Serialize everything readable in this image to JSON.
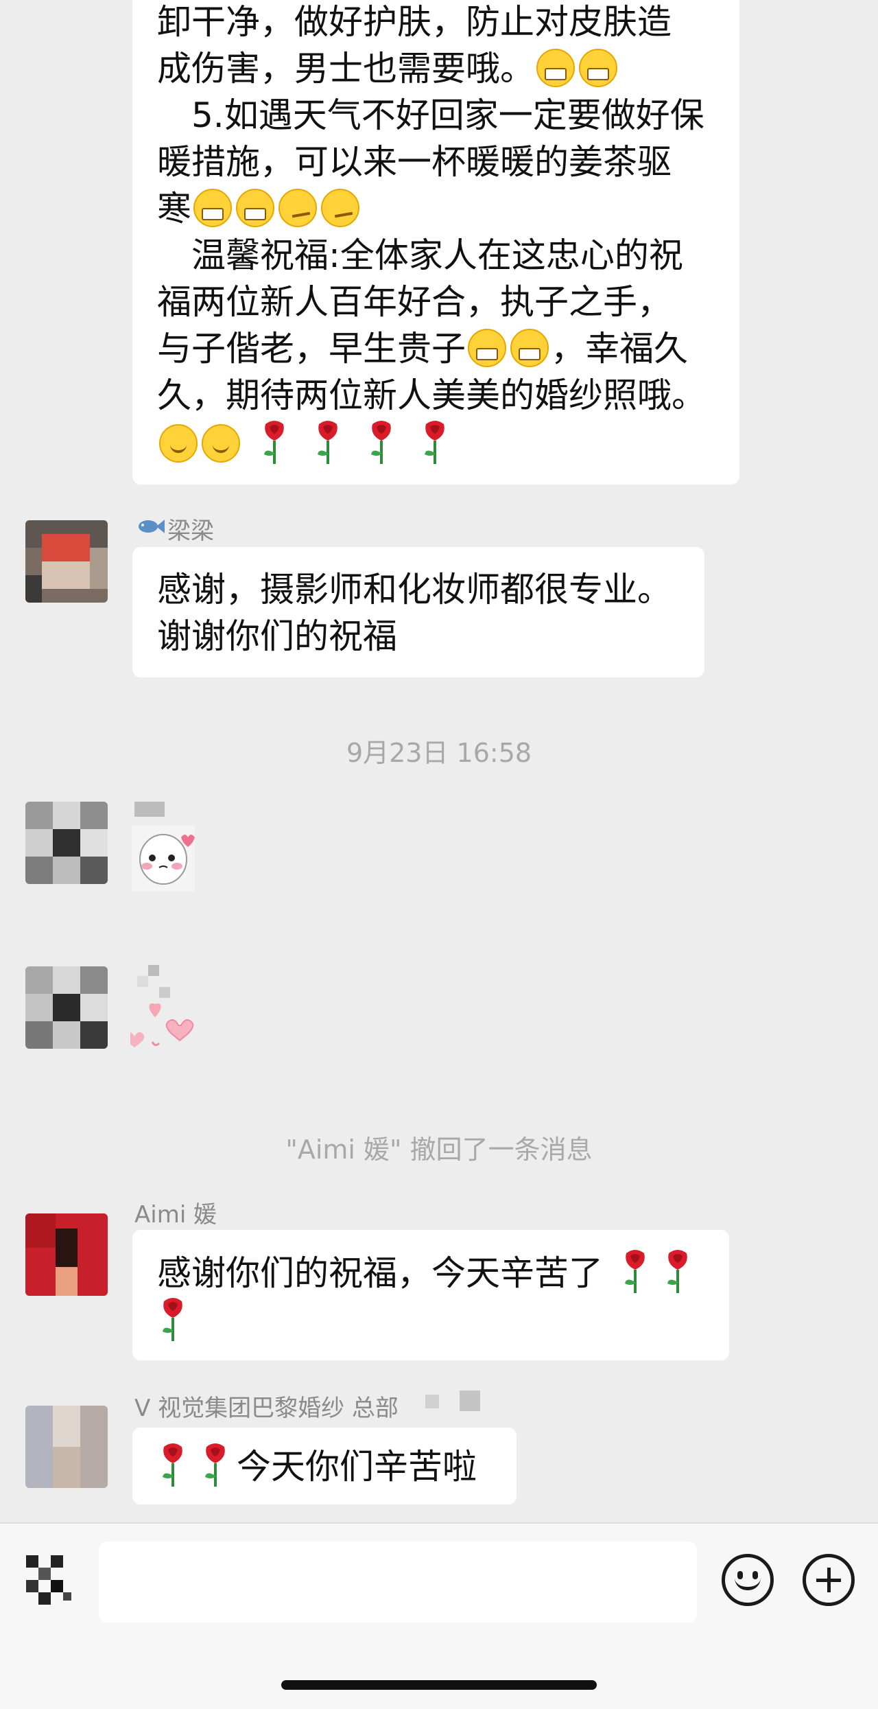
{
  "chat": {
    "messages": {
      "first": {
        "lines": [
          "卸干净，做好护肤，防止对皮肤造",
          "成伤害，男士也需要哦。",
          "　5.如遇天气不好回家一定要做好保",
          "暖措施，可以来一杯暖暖的姜茶驱",
          "寒",
          "　温馨祝福:全体家人在这忠心的祝",
          "福两位新人百年好合，执子之手，",
          "与子偕老，早生贵子",
          "，幸福久",
          "久，期待两位新人美美的婚纱照哦。"
        ]
      },
      "liangliang": {
        "sender": "梁梁",
        "lines": [
          "感谢，摄影师和化妆师都很专业。",
          "谢谢你们的祝福"
        ]
      },
      "aimi": {
        "sender": "Aimi 媛",
        "lines": [
          "感谢你们的祝福，今天辛苦了"
        ]
      },
      "vvision": {
        "sender": "V 视觉集团巴黎婚纱 总部",
        "text": "今天你们辛苦啦"
      }
    },
    "timestamp": "9月23日 16:58",
    "recall_notice": "\"Aimi 媛\" 撤回了一条消息"
  },
  "icons": {
    "grin": "grinning-face-emoji",
    "smile": "smiling-face-emoji",
    "smirk": "smirking-face-emoji",
    "rose": "rose-emoji",
    "fish": "fish-icon",
    "emoji_button": "smiley-icon",
    "plus_button": "plus-icon",
    "voice_toggle": "voice-icon"
  },
  "colors": {
    "background": "#ededed",
    "bubble": "#ffffff",
    "meta_text": "#a8a8a8",
    "sender_text": "#8a8a8a"
  }
}
